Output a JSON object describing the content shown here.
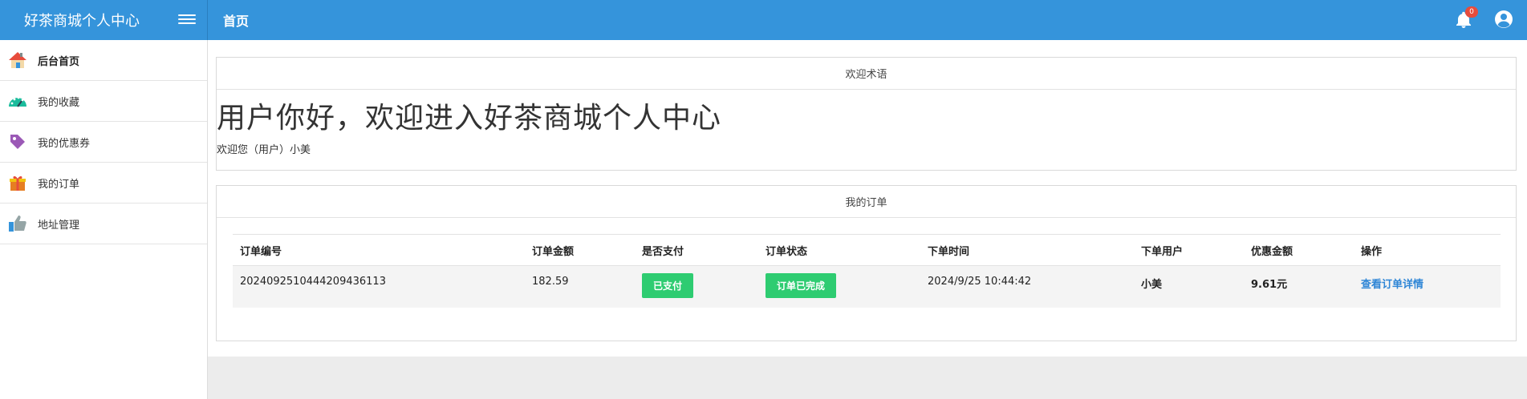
{
  "header": {
    "brand": "好茶商城个人中心",
    "page_title": "首页",
    "notification_count": "0"
  },
  "sidebar": {
    "items": [
      {
        "label": "后台首页",
        "icon": "home-icon"
      },
      {
        "label": "我的收藏",
        "icon": "dashboard-icon"
      },
      {
        "label": "我的优惠券",
        "icon": "tag-icon"
      },
      {
        "label": "我的订单",
        "icon": "gift-icon"
      },
      {
        "label": "地址管理",
        "icon": "thumbs-up-icon"
      }
    ]
  },
  "welcome": {
    "panel_title": "欢迎术语",
    "headline": "用户你好，欢迎进入好茶商城个人中心",
    "subline": "欢迎您（用户）小美"
  },
  "orders": {
    "panel_title": "我的订单",
    "columns": [
      "订单编号",
      "订单金额",
      "是否支付",
      "订单状态",
      "下单时间",
      "下单用户",
      "优惠金额",
      "操作"
    ],
    "rows": [
      {
        "order_no": "20240925104442094361​13",
        "amount": "182.59",
        "paid": "已支付",
        "status": "订单已完成",
        "time": "2024/9/25 10:44:42",
        "user": "小美",
        "discount": "9.61元",
        "action": "查看订单详情"
      }
    ]
  },
  "colors": {
    "topbar": "#3594db",
    "badge": "#e74c3c",
    "success": "#2ecc71",
    "link": "#2f86d6"
  }
}
